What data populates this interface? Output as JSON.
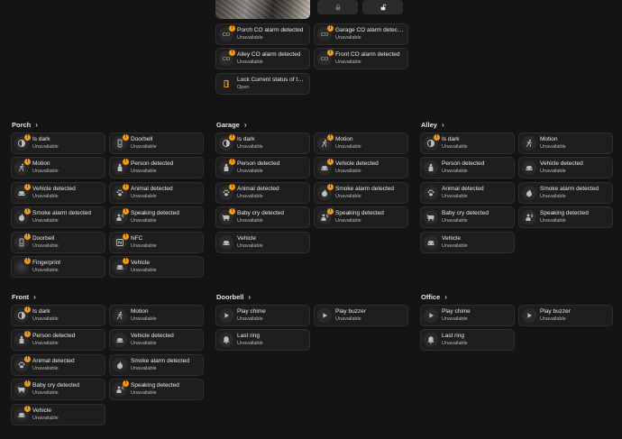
{
  "top": {
    "cards": [
      {
        "name": "Porch CO alarm detected",
        "state": "Unavailable",
        "icon": "co-alarm-icon",
        "badge": "!"
      },
      {
        "name": "Garage CO alarm detected",
        "state": "Unavailable",
        "icon": "co-alarm-icon",
        "badge": "!"
      },
      {
        "name": "Alley CO alarm detected",
        "state": "Unavailable",
        "icon": "co-alarm-icon",
        "badge": "!"
      },
      {
        "name": "Front CO alarm detected",
        "state": "Unavailable",
        "icon": "co-alarm-icon",
        "badge": "!"
      },
      {
        "name": "Lock Current status of the ...",
        "state": "Open",
        "icon": "door-open-icon",
        "badge": ""
      }
    ]
  },
  "sections": [
    {
      "title": "Porch",
      "cards": [
        {
          "name": "Is dark",
          "state": "Unavailable",
          "icon": "brightness-icon",
          "badge": "!"
        },
        {
          "name": "Doorbell",
          "state": "Unavailable",
          "icon": "doorbell-icon",
          "badge": "!"
        },
        {
          "name": "Motion",
          "state": "Unavailable",
          "icon": "motion-icon",
          "badge": "!"
        },
        {
          "name": "Person detected",
          "state": "Unavailable",
          "icon": "person-icon",
          "badge": "!"
        },
        {
          "name": "Vehicle detected",
          "state": "Unavailable",
          "icon": "car-icon",
          "badge": "!"
        },
        {
          "name": "Animal detected",
          "state": "Unavailable",
          "icon": "paw-icon",
          "badge": "!"
        },
        {
          "name": "Smoke alarm detected",
          "state": "Unavailable",
          "icon": "fire-icon",
          "badge": "!"
        },
        {
          "name": "Speaking detected",
          "state": "Unavailable",
          "icon": "speaking-icon",
          "badge": "!"
        },
        {
          "name": "Doorbell",
          "state": "Unavailable",
          "icon": "doorbell-icon",
          "badge": "!"
        },
        {
          "name": "NFC",
          "state": "Unavailable",
          "icon": "nfc-icon",
          "badge": "!"
        },
        {
          "name": "Fingerprint",
          "state": "Unavailable",
          "icon": "circle-icon",
          "badge": "!"
        },
        {
          "name": "Vehicle",
          "state": "Unavailable",
          "icon": "car-icon",
          "badge": "!"
        }
      ]
    },
    {
      "title": "Garage",
      "cards": [
        {
          "name": "Is dark",
          "state": "Unavailable",
          "icon": "brightness-icon",
          "badge": "!"
        },
        {
          "name": "Motion",
          "state": "Unavailable",
          "icon": "motion-icon",
          "badge": "!"
        },
        {
          "name": "Person detected",
          "state": "Unavailable",
          "icon": "person-icon",
          "badge": "!"
        },
        {
          "name": "Vehicle detected",
          "state": "Unavailable",
          "icon": "car-icon",
          "badge": "!"
        },
        {
          "name": "Animal detected",
          "state": "Unavailable",
          "icon": "paw-icon",
          "badge": "!"
        },
        {
          "name": "Smoke alarm detected",
          "state": "Unavailable",
          "icon": "fire-icon",
          "badge": "!"
        },
        {
          "name": "Baby cry detected",
          "state": "Unavailable",
          "icon": "baby-icon",
          "badge": "!"
        },
        {
          "name": "Speaking detected",
          "state": "Unavailable",
          "icon": "speaking-icon",
          "badge": "!"
        },
        {
          "name": "Vehicle",
          "state": "Unavailable",
          "icon": "car-icon",
          "badge": ""
        }
      ]
    },
    {
      "title": "Alley",
      "cards": [
        {
          "name": "Is dark",
          "state": "Unavailable",
          "icon": "brightness-icon",
          "badge": "!"
        },
        {
          "name": "Motion",
          "state": "Unavailable",
          "icon": "motion-icon",
          "badge": ""
        },
        {
          "name": "Person detected",
          "state": "Unavailable",
          "icon": "person-icon",
          "badge": ""
        },
        {
          "name": "Vehicle detected",
          "state": "Unavailable",
          "icon": "car-icon",
          "badge": ""
        },
        {
          "name": "Animal detected",
          "state": "Unavailable",
          "icon": "paw-icon",
          "badge": ""
        },
        {
          "name": "Smoke alarm detected",
          "state": "Unavailable",
          "icon": "fire-icon",
          "badge": ""
        },
        {
          "name": "Baby cry detected",
          "state": "Unavailable",
          "icon": "baby-icon",
          "badge": ""
        },
        {
          "name": "Speaking detected",
          "state": "Unavailable",
          "icon": "speaking-icon",
          "badge": ""
        },
        {
          "name": "Vehicle",
          "state": "Unavailable",
          "icon": "car-icon",
          "badge": ""
        }
      ]
    },
    {
      "title": "Front",
      "cards": [
        {
          "name": "Is dark",
          "state": "Unavailable",
          "icon": "brightness-icon",
          "badge": "!"
        },
        {
          "name": "Motion",
          "state": "Unavailable",
          "icon": "motion-icon",
          "badge": ""
        },
        {
          "name": "Person detected",
          "state": "Unavailable",
          "icon": "person-icon",
          "badge": "!"
        },
        {
          "name": "Vehicle detected",
          "state": "Unavailable",
          "icon": "car-icon",
          "badge": ""
        },
        {
          "name": "Animal detected",
          "state": "Unavailable",
          "icon": "paw-icon",
          "badge": "!"
        },
        {
          "name": "Smoke alarm detected",
          "state": "Unavailable",
          "icon": "fire-icon",
          "badge": ""
        },
        {
          "name": "Baby cry detected",
          "state": "Unavailable",
          "icon": "baby-icon",
          "badge": "!"
        },
        {
          "name": "Speaking detected",
          "state": "Unavailable",
          "icon": "speaking-icon",
          "badge": "!"
        },
        {
          "name": "Vehicle",
          "state": "Unavailable",
          "icon": "car-icon",
          "badge": "!"
        }
      ]
    },
    {
      "title": "Doorbell",
      "cards": [
        {
          "name": "Play chime",
          "state": "Unavailable",
          "icon": "play-icon",
          "badge": ""
        },
        {
          "name": "Play buzzer",
          "state": "Unavailable",
          "icon": "play-icon",
          "badge": ""
        },
        {
          "name": "Last ring",
          "state": "Unavailable",
          "icon": "bell-icon",
          "badge": ""
        }
      ]
    },
    {
      "title": "Office",
      "cards": [
        {
          "name": "Play chime",
          "state": "Unavailable",
          "icon": "play-icon",
          "badge": ""
        },
        {
          "name": "Play buzzer",
          "state": "Unavailable",
          "icon": "play-icon",
          "badge": ""
        },
        {
          "name": "Last ring",
          "state": "Unavailable",
          "icon": "bell-icon",
          "badge": ""
        }
      ]
    }
  ],
  "colors": {
    "badge": "#f29a16",
    "accent": "#f29a16",
    "background": "#141414",
    "card": "#1e1e1e"
  }
}
